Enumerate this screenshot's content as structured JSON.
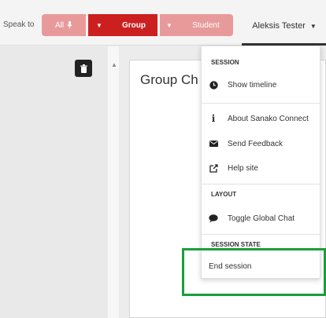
{
  "toolbar": {
    "speak_to": "Speak to",
    "all_label": "All",
    "group_label": "Group",
    "student_label": "Student",
    "user_name": "Aleksis Tester"
  },
  "chat": {
    "title": "Group Ch"
  },
  "menu": {
    "session_header": "SESSION",
    "show_timeline": "Show timeline",
    "about": "About Sanako Connect",
    "send_feedback": "Send Feedback",
    "help_site": "Help site",
    "layout_header": "LAYOUT",
    "toggle_global_chat": "Toggle Global Chat",
    "session_state_header": "SESSION STATE",
    "end_session": "End session"
  },
  "colors": {
    "accent_red": "#cc2020",
    "light_red": "#e89a9a",
    "highlight_green": "#1a9e3a"
  },
  "icons": [
    "microphone-icon",
    "caret-down-icon",
    "trash-icon",
    "clock-icon",
    "info-icon",
    "envelope-icon",
    "external-link-icon",
    "chat-bubble-icon"
  ]
}
